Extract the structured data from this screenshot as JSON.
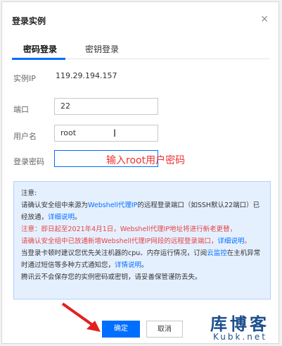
{
  "dialog": {
    "title": "登录实例",
    "close_glyph": "×"
  },
  "tabs": [
    {
      "label": "密码登录",
      "active": true
    },
    {
      "label": "密钥登录",
      "active": false
    }
  ],
  "form": {
    "instance_ip_label": "实例IP",
    "instance_ip_value": "119.29.194.157",
    "port_label": "端口",
    "port_value": "22",
    "username_label": "用户名",
    "username_value": "root",
    "password_label": "登录密码",
    "password_value": ""
  },
  "annotation": "输入root用户密码",
  "notice": {
    "heading": "注意:",
    "line1a": "请确认安全组中来源为",
    "line1b": "Webshell代理IP",
    "line1c": "的远程登录端口（如SSH默认22端口）已经放通，",
    "line1d": "详细说明",
    "line1e": "。",
    "line2": "注意：即日起至2021年4月1日，Webshell代理IP地址将进行新老更替，",
    "line3a": "请确认安全组中已放通新增Webshell代理IP网段的远程登录端口，",
    "line3b": "详细说明",
    "line3c": "。",
    "line4a": "当登录卡顿时建议您优先关注机器的cpu、内存运行情况，订阅",
    "line4b": "云监控",
    "line4c": "在主机异常时通过短信等多种方式通知您，",
    "line4d": "详情说明",
    "line4e": "。",
    "line5": "腾讯云不会保存您的实例密码或密钥，请妥善保管谨防丢失。"
  },
  "buttons": {
    "ok_label": "确定",
    "cancel_label": "取消"
  },
  "watermark": {
    "title": "库博客",
    "subtitle": "Kubk.net"
  },
  "colors": {
    "accent": "#006eff",
    "annotation": "#e33333",
    "warning": "#e54545",
    "notice_bg": "#e5f0ff"
  }
}
